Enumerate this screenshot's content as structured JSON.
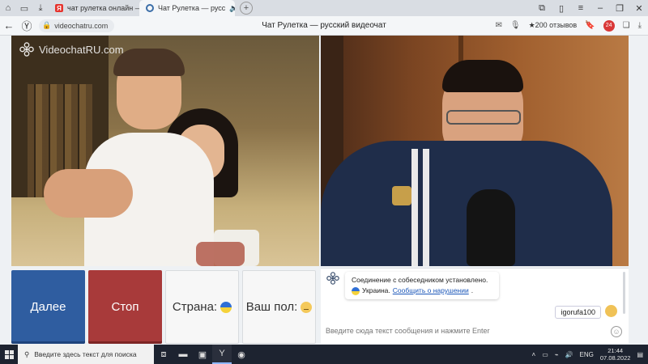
{
  "browser": {
    "tabs": [
      {
        "label": "чат рулетка онлайн — Ян",
        "active": false
      },
      {
        "label": "Чат Рулетка — русс",
        "active": true
      }
    ],
    "new_tab_label": "+",
    "url": "videochatru.com",
    "page_title": "Чат Рулетка — русский видеочат",
    "reviews": "★200 отзывов",
    "ext_badge": "24"
  },
  "logo": {
    "text": "VideochatRU.com"
  },
  "controls": {
    "next_label": "Далее",
    "stop_label": "Стоп",
    "country_label": "Страна:",
    "gender_label": "Ваш пол:"
  },
  "chat": {
    "system_message_line1": "Соединение с собеседником установлено.",
    "system_country": "Украина.",
    "report_link": "Сообщить о нарушении",
    "report_link_suffix": ".",
    "user_message": "igorufa100",
    "input_placeholder": "Введите сюда текст сообщения и нажмите Enter"
  },
  "taskbar": {
    "search_placeholder": "Введите здесь текст для поиска",
    "language": "ENG",
    "time": "21:44",
    "date": "07.08.2022"
  },
  "colors": {
    "next_button": "#2f5da0",
    "stop_button": "#a83a3a",
    "link": "#1a56b8",
    "taskbar": "#1d2330"
  }
}
